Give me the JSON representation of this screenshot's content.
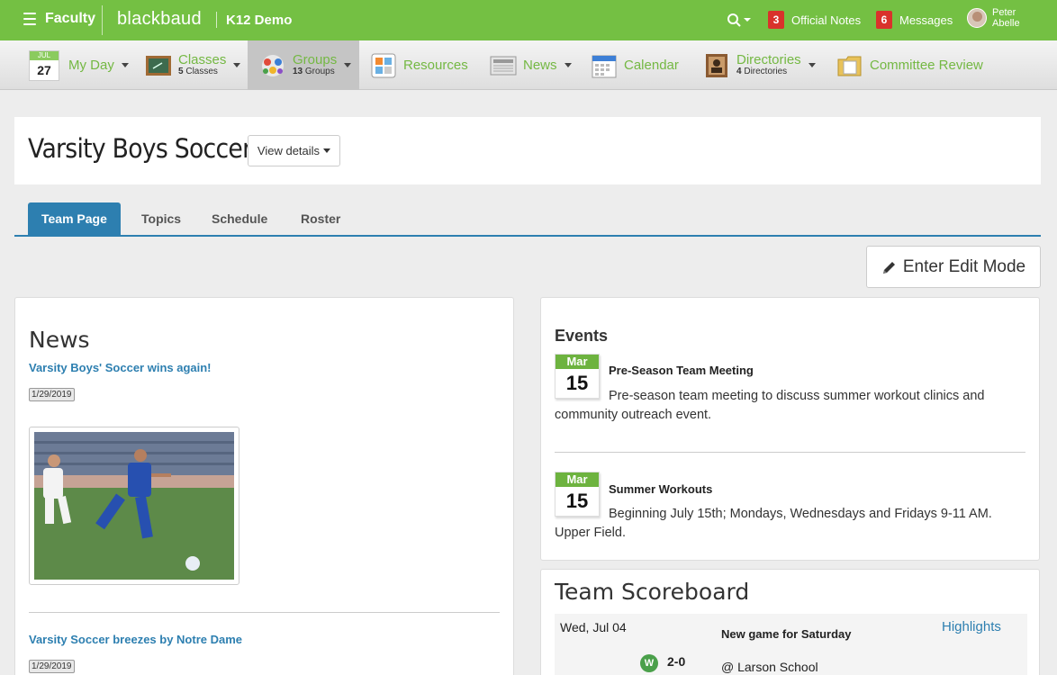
{
  "topbar": {
    "role": "Faculty",
    "brand": "blackbaud",
    "environment": "K12 Demo",
    "official_notes": {
      "count": "3",
      "label": "Official Notes"
    },
    "messages": {
      "count": "6",
      "label": "Messages"
    },
    "user": {
      "first": "Peter",
      "last": "Abelle"
    }
  },
  "nav": {
    "myday": {
      "month": "JUL",
      "day": "27",
      "label": "My Day"
    },
    "classes": {
      "label": "Classes",
      "count": "5",
      "sub": "Classes"
    },
    "groups": {
      "label": "Groups",
      "count": "13",
      "sub": "Groups"
    },
    "resources": {
      "label": "Resources"
    },
    "news": {
      "label": "News"
    },
    "calendar": {
      "label": "Calendar"
    },
    "directories": {
      "label": "Directories",
      "count": "4",
      "sub": "Directories"
    },
    "committee": {
      "label": "Committee Review"
    }
  },
  "page": {
    "title": "Varsity Boys Soccer",
    "view_details": "View details",
    "edit_mode": "Enter Edit Mode"
  },
  "tabs": [
    "Team Page",
    "Topics",
    "Schedule",
    "Roster"
  ],
  "news": {
    "heading": "News",
    "items": [
      {
        "title": "Varsity Boys' Soccer wins again!",
        "date": "1/29/2019"
      },
      {
        "title": "Varsity Soccer breezes by Notre Dame",
        "date": "1/29/2019"
      }
    ]
  },
  "events": {
    "heading": "Events",
    "items": [
      {
        "month": "Mar",
        "day": "15",
        "title": "Pre-Season Team Meeting",
        "description": "Pre-season team meeting to discuss summer workout clinics and community outreach event."
      },
      {
        "month": "Mar",
        "day": "15",
        "title": "Summer Workouts",
        "description": "Beginning July 15th; Mondays, Wednesdays and Fridays 9-11 AM. Upper Field."
      }
    ]
  },
  "scoreboard": {
    "heading": "Team Scoreboard",
    "games": [
      {
        "date": "Wed, Jul 04",
        "title": "New game for Saturday",
        "link": "Highlights",
        "result": "W",
        "score": "2-0",
        "opponent": "@ Larson School"
      }
    ]
  },
  "colors": {
    "brand_green": "#74c043",
    "link_blue": "#2d7fb0",
    "badge_red": "#d9322b"
  }
}
